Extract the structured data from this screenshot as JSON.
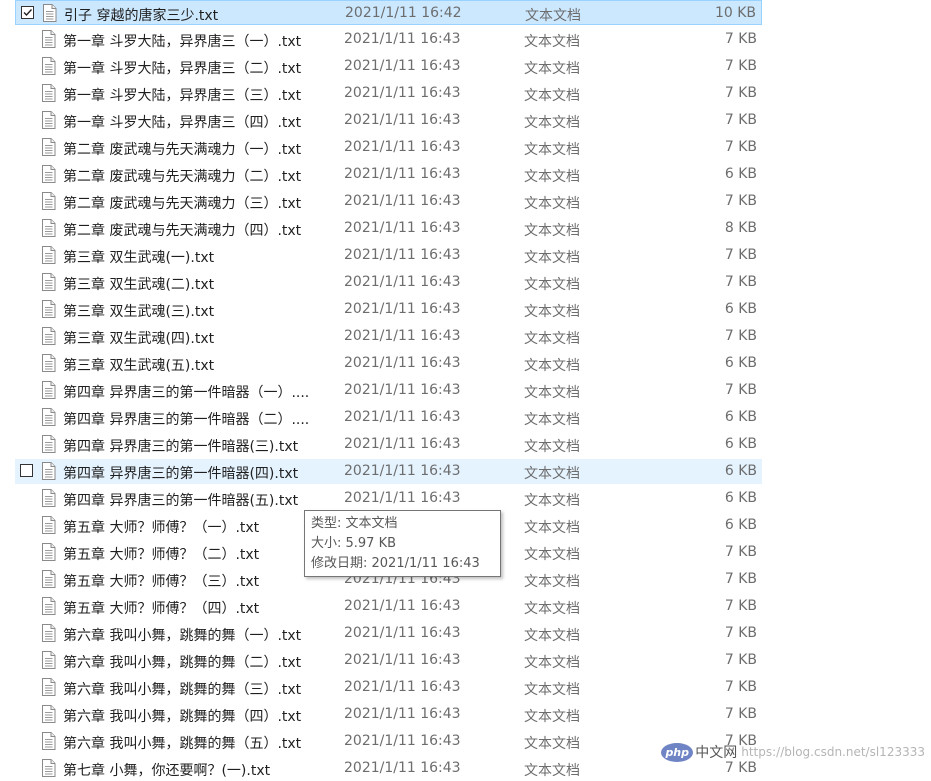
{
  "file_list": {
    "rows": [
      {
        "name": "引子 穿越的唐家三少.txt",
        "modified": "2021/1/11 16:42",
        "type": "文本文档",
        "size": "10 KB",
        "checked": true,
        "state": "selected"
      },
      {
        "name": "第一章 斗罗大陆，异界唐三（一）.txt",
        "modified": "2021/1/11 16:43",
        "type": "文本文档",
        "size": "7 KB"
      },
      {
        "name": "第一章 斗罗大陆，异界唐三（二）.txt",
        "modified": "2021/1/11 16:43",
        "type": "文本文档",
        "size": "7 KB"
      },
      {
        "name": "第一章 斗罗大陆，异界唐三（三）.txt",
        "modified": "2021/1/11 16:43",
        "type": "文本文档",
        "size": "7 KB"
      },
      {
        "name": "第一章 斗罗大陆，异界唐三（四）.txt",
        "modified": "2021/1/11 16:43",
        "type": "文本文档",
        "size": "7 KB"
      },
      {
        "name": "第二章 废武魂与先天满魂力（一）.txt",
        "modified": "2021/1/11 16:43",
        "type": "文本文档",
        "size": "7 KB"
      },
      {
        "name": "第二章 废武魂与先天满魂力（二）.txt",
        "modified": "2021/1/11 16:43",
        "type": "文本文档",
        "size": "6 KB"
      },
      {
        "name": "第二章 废武魂与先天满魂力（三）.txt",
        "modified": "2021/1/11 16:43",
        "type": "文本文档",
        "size": "7 KB"
      },
      {
        "name": "第二章 废武魂与先天满魂力（四）.txt",
        "modified": "2021/1/11 16:43",
        "type": "文本文档",
        "size": "8 KB"
      },
      {
        "name": "第三章 双生武魂(一).txt",
        "modified": "2021/1/11 16:43",
        "type": "文本文档",
        "size": "7 KB"
      },
      {
        "name": "第三章 双生武魂(二).txt",
        "modified": "2021/1/11 16:43",
        "type": "文本文档",
        "size": "7 KB"
      },
      {
        "name": "第三章 双生武魂(三).txt",
        "modified": "2021/1/11 16:43",
        "type": "文本文档",
        "size": "6 KB"
      },
      {
        "name": "第三章 双生武魂(四).txt",
        "modified": "2021/1/11 16:43",
        "type": "文本文档",
        "size": "7 KB"
      },
      {
        "name": "第三章 双生武魂(五).txt",
        "modified": "2021/1/11 16:43",
        "type": "文本文档",
        "size": "6 KB"
      },
      {
        "name": "第四章 异界唐三的第一件暗器（一）....",
        "modified": "2021/1/11 16:43",
        "type": "文本文档",
        "size": "7 KB"
      },
      {
        "name": "第四章 异界唐三的第一件暗器（二）....",
        "modified": "2021/1/11 16:43",
        "type": "文本文档",
        "size": "6 KB"
      },
      {
        "name": "第四章 异界唐三的第一件暗器(三).txt",
        "modified": "2021/1/11 16:43",
        "type": "文本文档",
        "size": "6 KB"
      },
      {
        "name": "第四章 异界唐三的第一件暗器(四).txt",
        "modified": "2021/1/11 16:43",
        "type": "文本文档",
        "size": "6 KB",
        "checked": false,
        "state": "hover"
      },
      {
        "name": "第四章 异界唐三的第一件暗器(五).txt",
        "modified": "2021/1/11 16:43",
        "type": "文本文档",
        "size": "6 KB"
      },
      {
        "name": "第五章 大师？师傅？（一）.txt",
        "modified": "2021/1/11 16:43",
        "type": "文本文档",
        "size": "6 KB"
      },
      {
        "name": "第五章 大师？师傅？（二）.txt",
        "modified": "2021/1/11 16:43",
        "type": "文本文档",
        "size": "7 KB"
      },
      {
        "name": "第五章 大师？师傅？（三）.txt",
        "modified": "2021/1/11 16:43",
        "type": "文本文档",
        "size": "7 KB"
      },
      {
        "name": "第五章 大师？师傅？（四）.txt",
        "modified": "2021/1/11 16:43",
        "type": "文本文档",
        "size": "7 KB"
      },
      {
        "name": "第六章 我叫小舞，跳舞的舞（一）.txt",
        "modified": "2021/1/11 16:43",
        "type": "文本文档",
        "size": "7 KB"
      },
      {
        "name": "第六章 我叫小舞，跳舞的舞（二）.txt",
        "modified": "2021/1/11 16:43",
        "type": "文本文档",
        "size": "7 KB"
      },
      {
        "name": "第六章 我叫小舞，跳舞的舞（三）.txt",
        "modified": "2021/1/11 16:43",
        "type": "文本文档",
        "size": "7 KB"
      },
      {
        "name": "第六章 我叫小舞，跳舞的舞（四）.txt",
        "modified": "2021/1/11 16:43",
        "type": "文本文档",
        "size": "7 KB"
      },
      {
        "name": "第六章 我叫小舞，跳舞的舞（五）.txt",
        "modified": "2021/1/11 16:43",
        "type": "文本文档",
        "size": "7 KB"
      },
      {
        "name": "第七章 小舞，你还要啊？(一).txt",
        "modified": "2021/1/11 16:43",
        "type": "文本文档",
        "size": "7 KB"
      }
    ]
  },
  "tooltip": {
    "type_line": "类型: 文本文档",
    "size_line": "大小: 5.97 KB",
    "modified_line": "修改日期: 2021/1/11 16:43"
  },
  "watermark": {
    "logo_text": "php",
    "site_name": "中文网",
    "url_text": "https://blog.csdn.net/sl123333"
  },
  "icons": {
    "file": "text-file-icon",
    "checkbox": "checkbox"
  },
  "colors": {
    "selected_bg": "#cce8ff",
    "selected_border": "#99d1ff",
    "hover_bg": "#e5f3ff",
    "secondary_text": "#6d6d6d"
  }
}
